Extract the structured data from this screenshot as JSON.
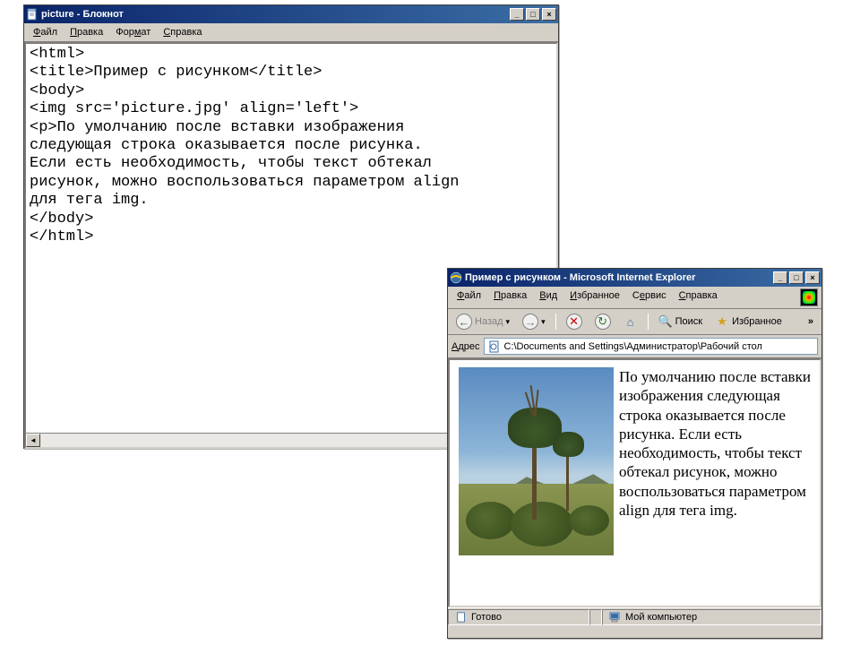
{
  "notepad": {
    "title": "picture - Блокнот",
    "menu": {
      "file": "Файл",
      "edit": "Правка",
      "format": "Формат",
      "help": "Справка"
    },
    "content": "<html>\n<title>Пример с рисунком</title>\n<body>\n<img src='picture.jpg' align='left'>\n<p>По умолчанию после вставки изображения\nследующая строка оказывается после рисунка.\nЕсли есть необходимость, чтобы текст обтекал\nрисунок, можно воспользоваться параметром align\nдля тега img.\n</body>\n</html>"
  },
  "ie": {
    "title": "Пример с рисунком - Microsoft Internet Explorer",
    "menu": {
      "file": "Файл",
      "edit": "Правка",
      "view": "Вид",
      "favorites": "Избранное",
      "tools": "Сервис",
      "help": "Справка"
    },
    "toolbar": {
      "back": "Назад",
      "search": "Поиск",
      "favorites": "Избранное"
    },
    "address_label": "Адрес",
    "address_value": "C:\\Documents and Settings\\Администратор\\Рабочий стол",
    "body_text": "По умолчанию после вставки изображения следующая строка оказывается после рисунка. Если есть необходимость, чтобы текст обтекал рисунок, можно воспользоваться параметром align для тега img.",
    "status": {
      "ready": "Готово",
      "location": "Мой компьютер"
    }
  }
}
